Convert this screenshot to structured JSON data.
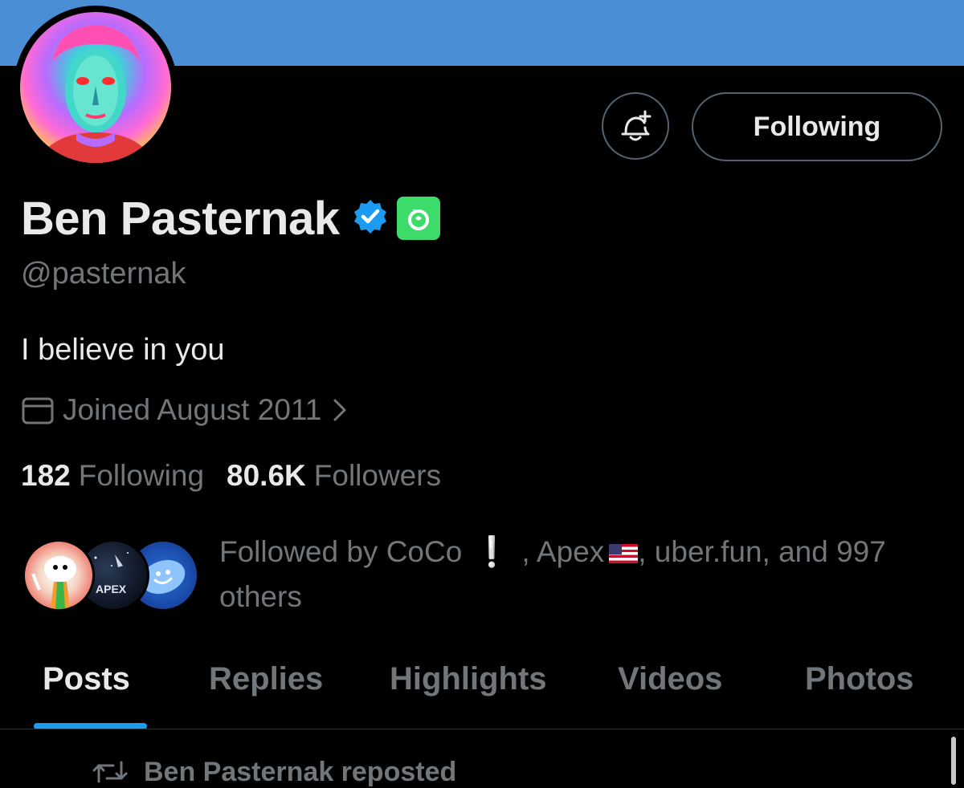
{
  "header": {
    "banner_color": "#4a8fd6"
  },
  "actions": {
    "notify_icon": "bell-plus-icon",
    "following_label": "Following"
  },
  "profile": {
    "display_name": "Ben Pasternak",
    "verified_icon": "verified-badge-icon",
    "app_badge_icon": "app-badge-icon",
    "handle": "@pasternak",
    "bio": "I believe in you",
    "joined": "Joined August 2011"
  },
  "stats": {
    "following_count": "182",
    "following_label": "Following",
    "followers_count": "80.6K",
    "followers_label": "Followers"
  },
  "followed_by": {
    "prefix": "Followed by CoCo",
    "exclamation": "❕",
    "middle": ", Apex",
    "suffix": ", uber.fun, and 997 others"
  },
  "tabs": [
    {
      "label": "Posts",
      "active": true
    },
    {
      "label": "Replies",
      "active": false
    },
    {
      "label": "Highlights",
      "active": false
    },
    {
      "label": "Videos",
      "active": false
    },
    {
      "label": "Photos",
      "active": false
    }
  ],
  "feed": {
    "repost_text": "Ben Pasternak reposted"
  },
  "colors": {
    "accent": "#1d9bf0",
    "verified": "#1d9bf0",
    "app_badge": "#3ddc6a"
  }
}
